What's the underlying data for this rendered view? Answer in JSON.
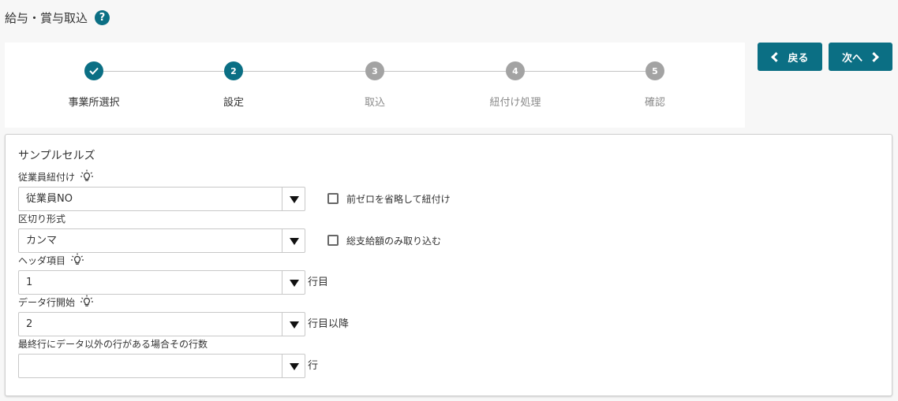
{
  "header": {
    "title": "給与・賞与取込",
    "help_icon": "question-icon"
  },
  "stepper": {
    "steps": [
      {
        "number": "",
        "label": "事業所選択",
        "state": "done"
      },
      {
        "number": "2",
        "label": "設定",
        "state": "active"
      },
      {
        "number": "3",
        "label": "取込",
        "state": "pending"
      },
      {
        "number": "4",
        "label": "紐付け処理",
        "state": "pending"
      },
      {
        "number": "5",
        "label": "確認",
        "state": "pending"
      }
    ]
  },
  "nav": {
    "back_label": "戻る",
    "next_label": "次へ"
  },
  "panel": {
    "title": "サンプルセルズ",
    "fields": {
      "employee_link": {
        "label": "従業員紐付け",
        "value": "従業員NO",
        "checkbox_label": "前ゼロを省略して紐付け"
      },
      "delimiter": {
        "label": "区切り形式",
        "value": "カンマ",
        "checkbox_label": "総支給額のみ取り込む"
      },
      "header_row": {
        "label": "ヘッダ項目",
        "value": "1",
        "suffix": "行目"
      },
      "data_start": {
        "label": "データ行開始",
        "value": "2",
        "suffix": "行目以降"
      },
      "footer_rows": {
        "label": "最終行にデータ以外の行がある場合その行数",
        "value": "",
        "suffix": "行"
      }
    }
  },
  "colors": {
    "accent": "#0b6f84",
    "pending": "#a3a3a3"
  }
}
